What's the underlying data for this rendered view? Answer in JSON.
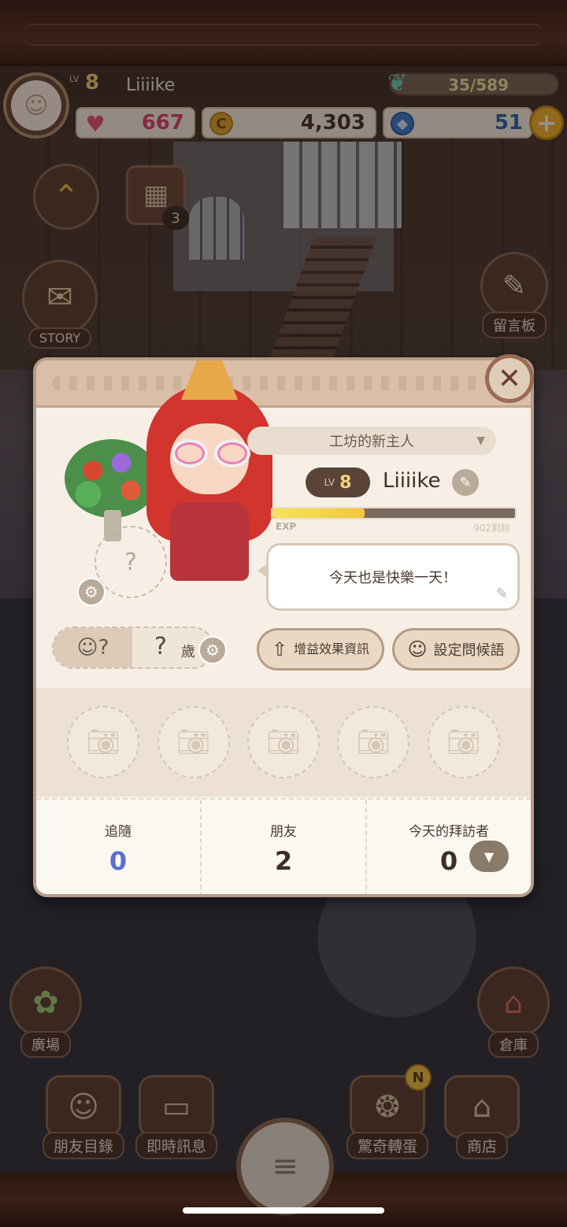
{
  "hud": {
    "level_label": "LV",
    "level": "8",
    "player_name": "Liiiike",
    "energy": "35/589",
    "hearts": "667",
    "coins": "4,303",
    "gems": "51"
  },
  "scene_buttons": {
    "calendar_count": "3",
    "story_label": "STORY",
    "memo_label": "留言板",
    "plaza_label": "廣場",
    "storage_label": "倉庫"
  },
  "bottom_nav": {
    "friends": "朋友目錄",
    "chat": "即時訊息",
    "gacha": "驚奇轉蛋",
    "gacha_badge": "N",
    "shop": "商店"
  },
  "profile": {
    "title": "工坊的新主人",
    "level_label": "LV",
    "level": "8",
    "name": "Liiiike",
    "exp_label": "EXP",
    "exp_progress": 0.38,
    "exp_remaining": "902剩餘",
    "status_message": "今天也是快樂一天！",
    "pet_placeholder": "?",
    "age_value": "?",
    "age_unit": "歲",
    "buff_button": "增益效果資訊",
    "greeting_button": "設定問候語",
    "stats": [
      {
        "label": "追隨",
        "value": "0"
      },
      {
        "label": "朋友",
        "value": "2"
      },
      {
        "label": "今天的拜訪者",
        "value": "0"
      }
    ]
  },
  "colors": {
    "accent_gold": "#f4d37a",
    "heart_pink": "#e0427a",
    "gem_blue": "#2d64b3",
    "modal_bg": "#f7efe5"
  },
  "icons": [
    "heart-icon",
    "coin-icon",
    "gem-icon",
    "leaf-icon",
    "gear-icon",
    "pencil-icon",
    "camera-icon",
    "close-icon",
    "chevron-down-icon"
  ]
}
